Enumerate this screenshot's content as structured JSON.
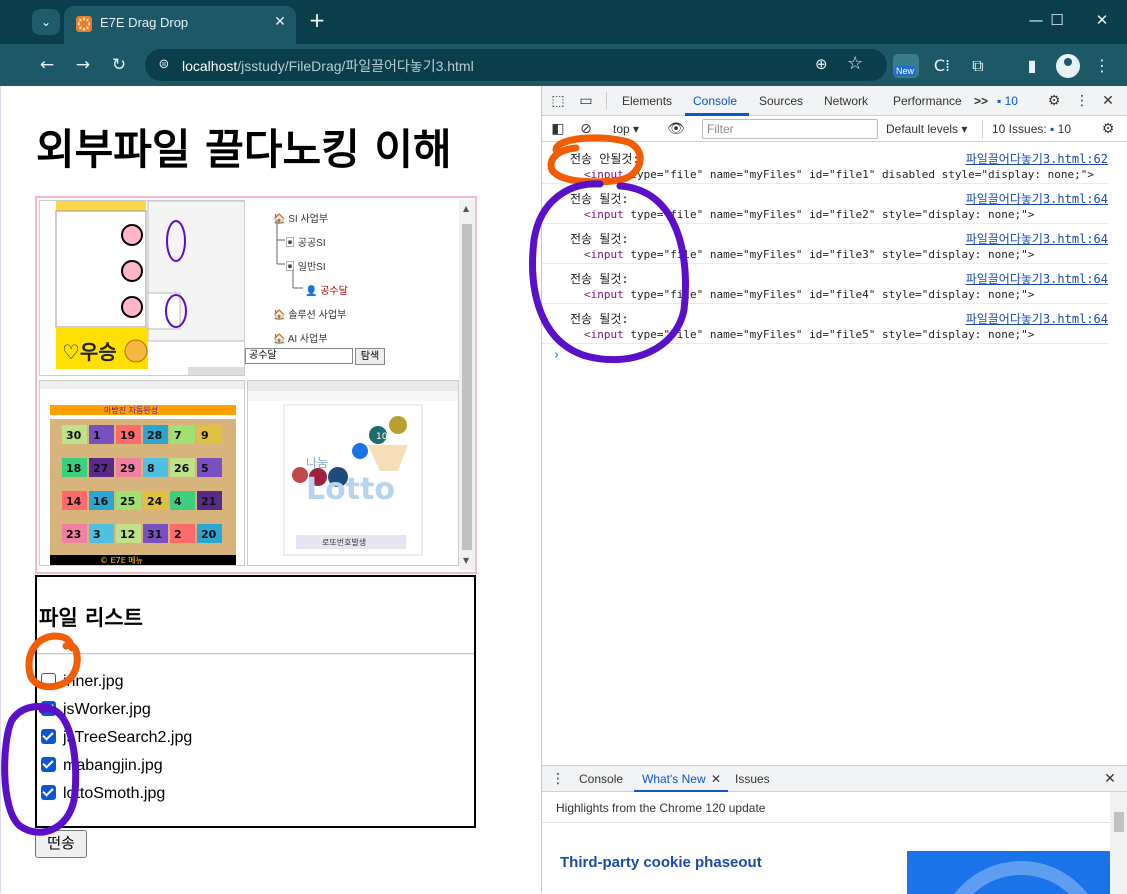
{
  "browser": {
    "tab_title": "E7E Drag Drop",
    "tab_favicon": "꙰",
    "url_host": "localhost",
    "url_path": "/jsstudy/FileDrag/파일끌어다놓기3.html",
    "profile_badge": "New"
  },
  "page": {
    "title": "외부파일 끌다노킹 이해",
    "file_list_heading": "파일 리스트",
    "files": [
      {
        "name": "inner.jpg",
        "checked": false
      },
      {
        "name": "jsWorker.jpg",
        "checked": true
      },
      {
        "name": "jsTreeSearch2.jpg",
        "checked": true
      },
      {
        "name": "mabangjin.jpg",
        "checked": true
      },
      {
        "name": "lottoSmoth.jpg",
        "checked": true
      }
    ],
    "send_button": "떤송",
    "thumbs": {
      "tree_items": [
        "SI 사업부",
        "공공SI",
        "일반SI",
        "공수달",
        "솔루션 사업부",
        "AI 사업부"
      ],
      "tree_search_value": "공수달",
      "tree_search_button": "탐색",
      "worker_caption": "♡우승",
      "magic_header": "마방진 자동완성",
      "magic_footer": "© E7E 메뉴",
      "magic_numbers": [
        "30",
        "1",
        "19",
        "28",
        "7",
        "9",
        "18",
        "27",
        "29",
        "8",
        "26",
        "5",
        "14",
        "16",
        "25",
        "24",
        "4",
        "21",
        "23",
        "3",
        "12",
        "31",
        "2",
        "20"
      ],
      "lotto_ball": "10",
      "lotto_logo_small": "나눔",
      "lotto_logo": "Lotto",
      "lotto_button": "로또번호발생"
    }
  },
  "devtools": {
    "tabs": [
      "Elements",
      "Console",
      "Sources",
      "Network",
      "Performance"
    ],
    "active_tab": "Console",
    "more": ">>",
    "message_count": "10",
    "context": "top",
    "filter_placeholder": "Filter",
    "levels": "Default levels",
    "issues_label": "10 Issues:",
    "issues_count": "10",
    "logs": [
      {
        "msg": "전송 안될것:",
        "src": "파일끌어다놓기3.html:62",
        "code_tag": "<input",
        "code_rest": " type=\"file\" name=\"myFiles\" id=\"file1\" disabled style=\"display: none;\">"
      },
      {
        "msg": "전송 될것:",
        "src": "파일끌어다놓기3.html:64",
        "code_tag": "<input",
        "code_rest": " type=\"file\" name=\"myFiles\" id=\"file2\" style=\"display: none;\">"
      },
      {
        "msg": "전송 될것:",
        "src": "파일끌어다놓기3.html:64",
        "code_tag": "<input",
        "code_rest": " type=\"file\" name=\"myFiles\" id=\"file3\" style=\"display: none;\">"
      },
      {
        "msg": "전송 될것:",
        "src": "파일끌어다놓기3.html:64",
        "code_tag": "<input",
        "code_rest": " type=\"file\" name=\"myFiles\" id=\"file4\" style=\"display: none;\">"
      },
      {
        "msg": "전송 될것:",
        "src": "파일끌어다놓기3.html:64",
        "code_tag": "<input",
        "code_rest": " type=\"file\" name=\"myFiles\" id=\"file5\" style=\"display: none;\">"
      }
    ],
    "drawer": {
      "tabs": [
        "Console",
        "What's New",
        "Issues"
      ],
      "active_tab": "What's New",
      "highlights": "Highlights from the Chrome 120 update",
      "article_title": "Third-party cookie phaseout"
    }
  },
  "colors": {
    "chrome_dark": "#0b3e4b",
    "chrome_toolbar": "#1d5866",
    "annotation_orange": "#f25c05",
    "annotation_purple": "#5a0fc8",
    "checkbox_blue": "#0b57d0",
    "drop_zone_border": "#f8b8c8"
  }
}
